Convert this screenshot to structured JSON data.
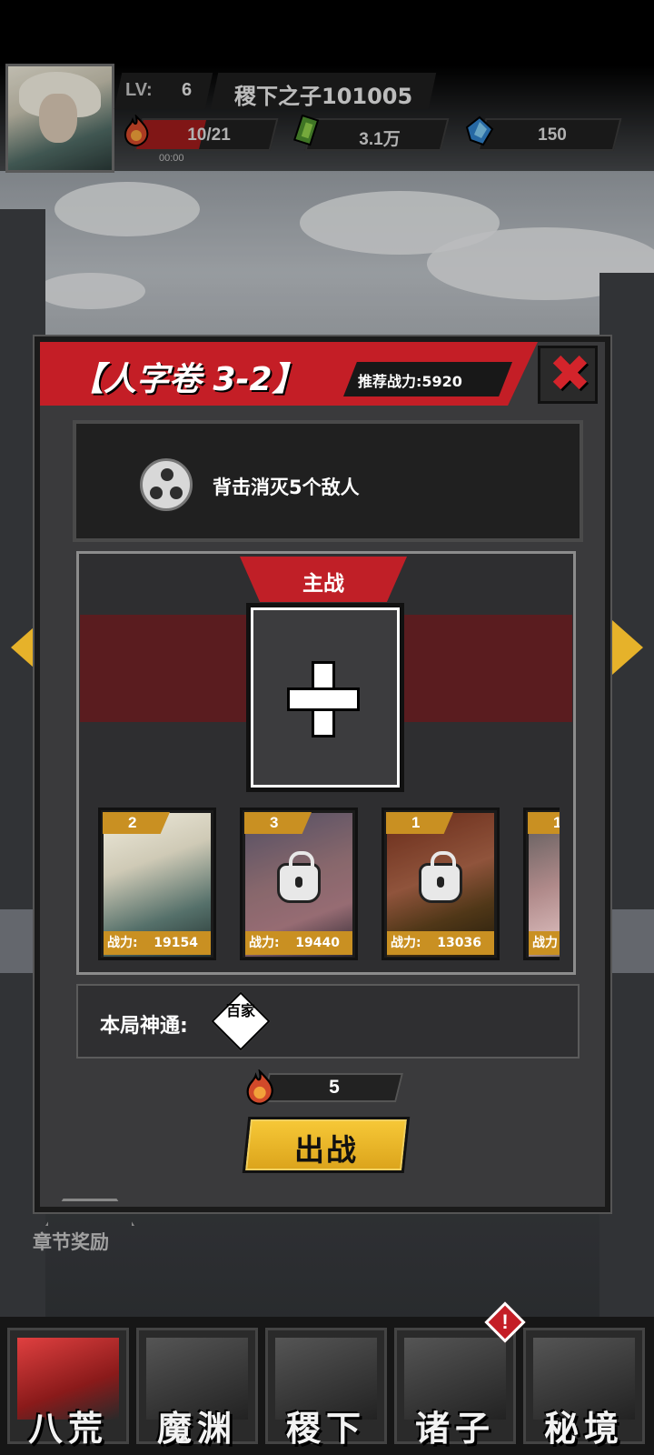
{
  "player": {
    "lv_label": "LV:",
    "lv_value": "6",
    "name": "稷下之子101005",
    "energy": "10/21",
    "energy_fraction": 0.476,
    "energy_timer": "00:00",
    "gold": "3.1万",
    "gems": "150"
  },
  "stage": {
    "title": "【人字卷 3-2】",
    "recommended_power": "推荐战力:5920",
    "close_label": "✖"
  },
  "mission": {
    "text": "背击消灭5个敌人"
  },
  "team": {
    "main_label": "主战",
    "heroes": [
      {
        "rank": "2",
        "power_label": "战力:",
        "power": "19154",
        "locked": false
      },
      {
        "rank": "3",
        "power_label": "战力:",
        "power": "19440",
        "locked": true
      },
      {
        "rank": "1",
        "power_label": "战力:",
        "power": "13036",
        "locked": true
      },
      {
        "rank": "1",
        "power_label": "战力",
        "power": "",
        "locked": true
      }
    ]
  },
  "skill": {
    "label": "本局神通:",
    "icon_text": "百家"
  },
  "battle": {
    "cost": "5",
    "fight_label": "出战"
  },
  "chapter_reward_label": "章节奖励",
  "nav": {
    "items": [
      {
        "label": "八荒",
        "active": true
      },
      {
        "label": "魔渊",
        "active": false
      },
      {
        "label": "稷下",
        "active": false
      },
      {
        "label": "诸子",
        "active": false
      },
      {
        "label": "秘境",
        "active": false
      }
    ],
    "alert": "!"
  },
  "colors": {
    "accent_red": "#c41e26",
    "accent_gold": "#c99022",
    "button_yellow": "#f7c938"
  }
}
